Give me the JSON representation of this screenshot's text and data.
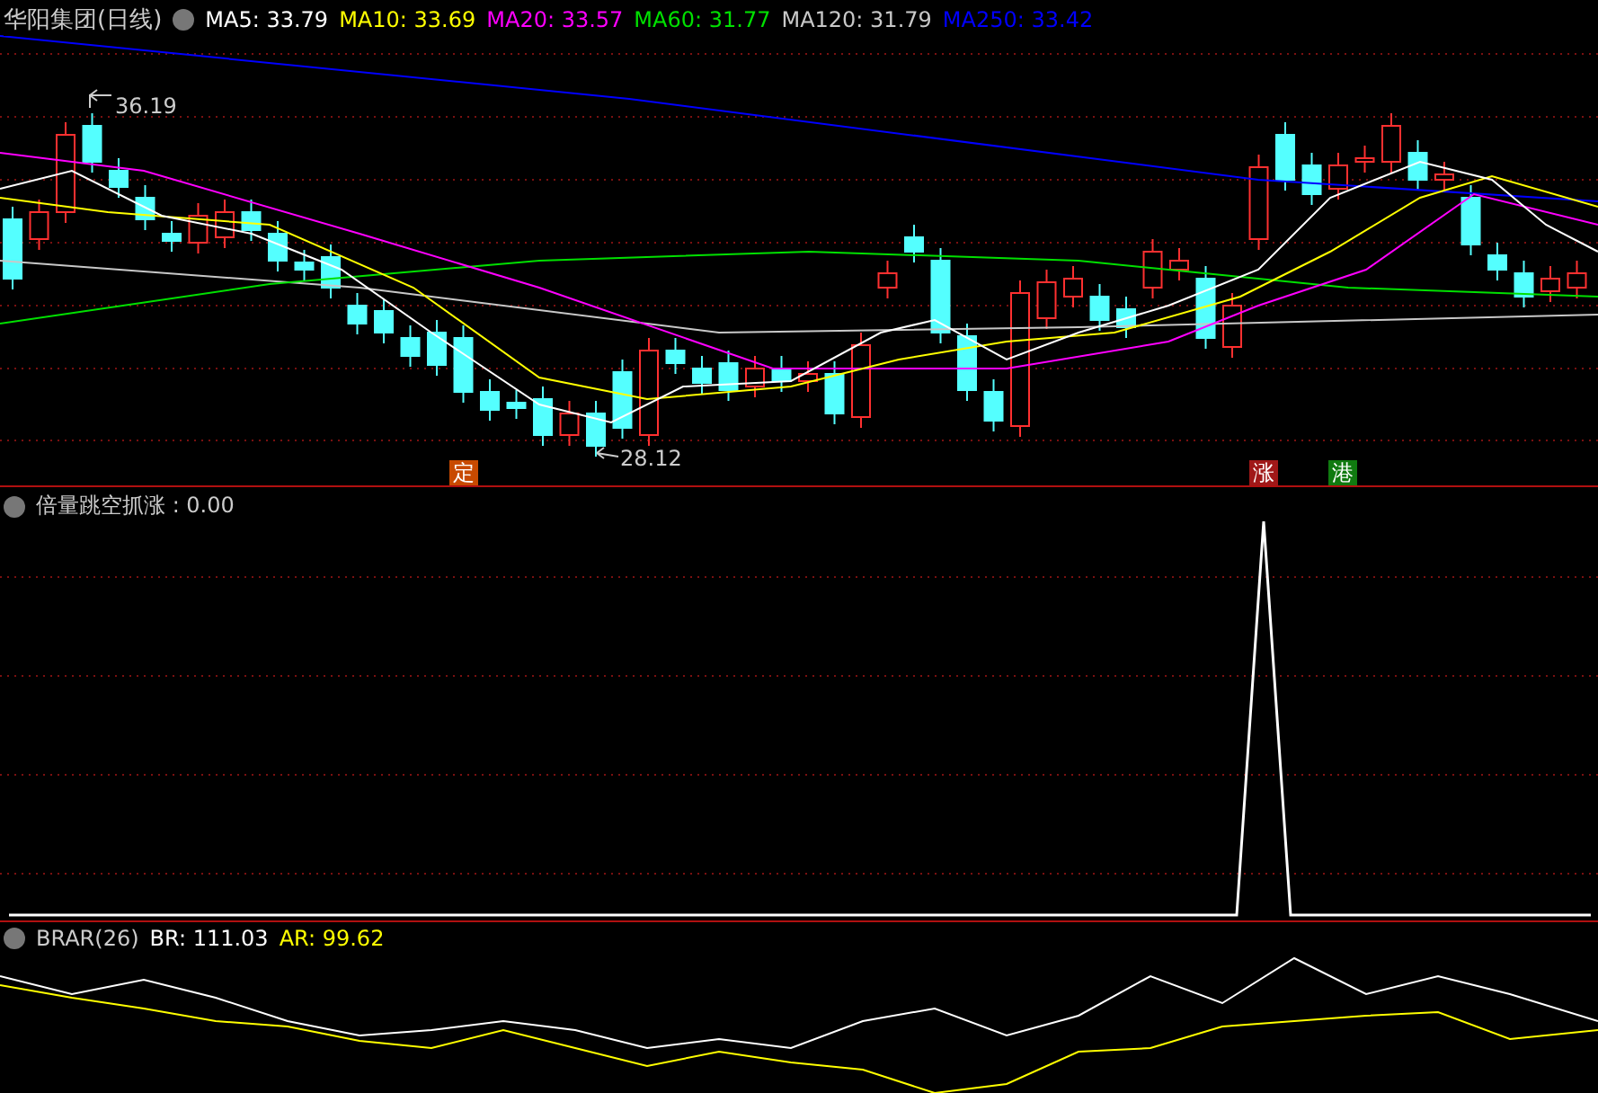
{
  "main_panel": {
    "title": "华阳集团(日线)",
    "indicators": [
      {
        "label": "MA5: 33.79",
        "color": "#ffffff"
      },
      {
        "label": "MA10: 33.69",
        "color": "#ffff00"
      },
      {
        "label": "MA20: 33.57",
        "color": "#ff00ff"
      },
      {
        "label": "MA60: 31.77",
        "color": "#00e000"
      },
      {
        "label": "MA120: 31.79",
        "color": "#c8c8c8"
      },
      {
        "label": "MA250: 33.42",
        "color": "#0000ff"
      }
    ],
    "high_label": "36.19",
    "low_label": "28.12",
    "markers": [
      {
        "text": "定",
        "color": "#c84a00"
      },
      {
        "text": "涨",
        "color": "#a01818"
      },
      {
        "text": "港",
        "color": "#107a10"
      }
    ]
  },
  "signal_panel": {
    "title": "倍量跳空抓涨 : 0.00"
  },
  "brar_panel": {
    "title": "BRAR(26)",
    "indicators": [
      {
        "label": "BR: 111.03",
        "color": "#ffffff"
      },
      {
        "label": "AR: 99.62",
        "color": "#ffff00"
      }
    ]
  }
}
